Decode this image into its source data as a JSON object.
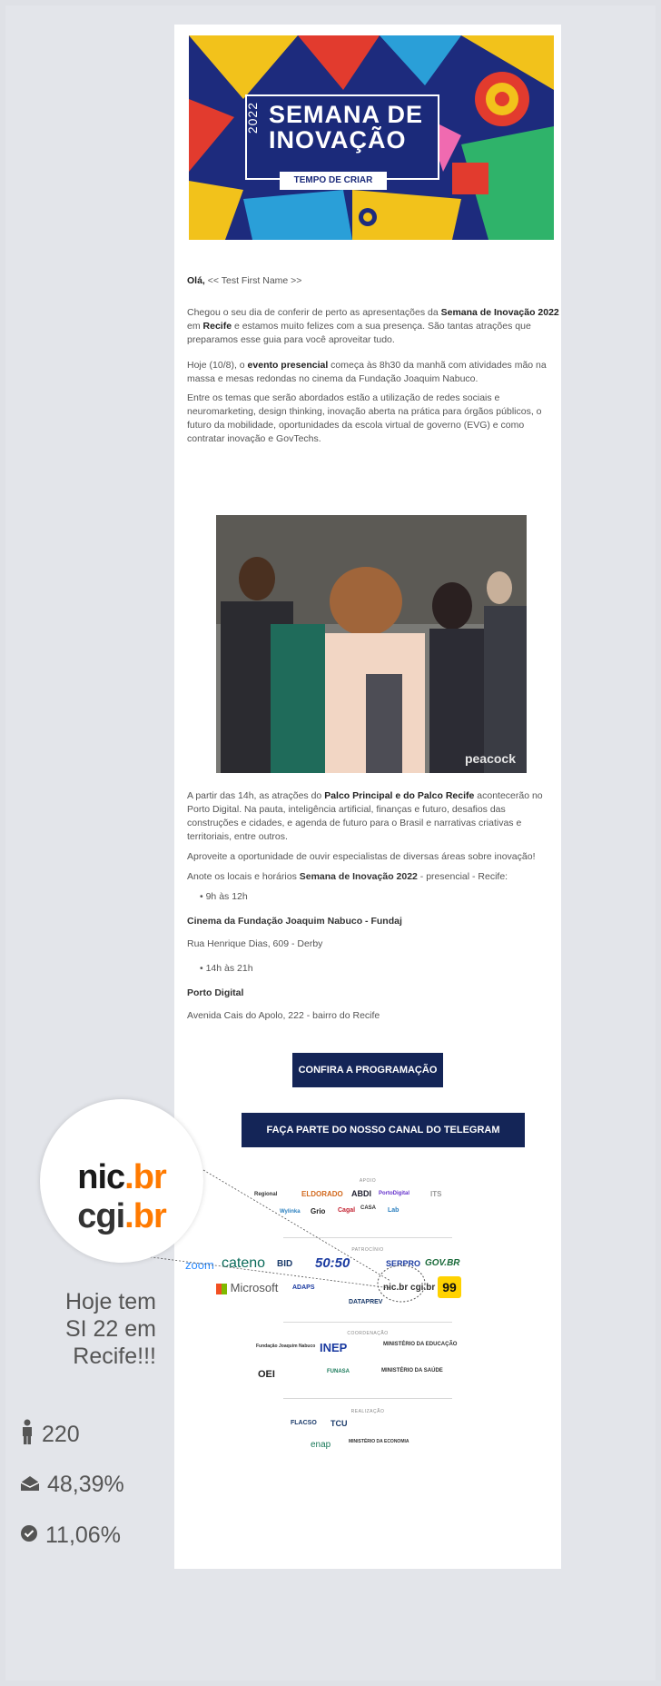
{
  "banner": {
    "year": "2022",
    "title_line1": "SEMANA DE",
    "title_line2": "INOVAÇÃO",
    "tagline": "TEMPO DE CRIAR"
  },
  "email": {
    "greeting_bold": "Olá,",
    "greeting_name": " << Test First Name >>",
    "p1_a": "Chegou o seu dia de conferir de perto as apresentações da ",
    "p1_b": "Semana de Inovação 2022",
    "p1_c": " em ",
    "p1_d": "Recife",
    "p1_e": " e estamos muito felizes com a sua presença. São tantas atrações que preparamos esse guia para você aproveitar tudo.",
    "p2_a": "Hoje (10/8), o ",
    "p2_b": "evento presencial",
    "p2_c": " começa às 8h30 da manhã com atividades mão na massa e mesas redondas no cinema da Fundação Joaquim Nabuco.",
    "p3": "Entre os temas que serão abordados estão a utilização de redes sociais e neuromarketing, design thinking, inovação aberta na prática para órgãos públicos, o futuro da mobilidade, oportunidades da escola virtual de governo (EVG) e como contratar inovação e GovTechs.",
    "gif_watermark": "peacock",
    "p4_a": "A partir das 14h, as atrações do ",
    "p4_b": "Palco Principal e do Palco Recife",
    "p4_c": " acontecerão no Porto Digital. Na pauta, inteligência artificial, finanças e futuro, desafios das construções e cidades, e agenda de futuro para o Brasil e narrativas criativas e territoriais, entre outros.",
    "p5": "Aproveite a oportunidade de ouvir especialistas de diversas áreas sobre inovação!",
    "p6_a": "Anote os  locais e horários ",
    "p6_b": "Semana de Inovação 2022",
    "p6_c": " - presencial - Recife:",
    "time1": "9h às 12h",
    "place1": "Cinema da Fundação Joaquim Nabuco - Fundaj",
    "addr1": "Rua Henrique Dias, 609 - Derby",
    "time2": "14h às 21h",
    "place2": "Porto Digital",
    "addr2": "Avenida Cais do Apolo, 222 - bairro do Recife",
    "btn_program": "CONFIRA A PROGRAMAÇÃO",
    "btn_telegram": "FAÇA PARTE DO NOSSO CANAL DO TELEGRAM"
  },
  "logos": {
    "apoio_label": "APOIO",
    "apoio": [
      "Regional",
      "ELDORADO",
      "ABDI",
      "PortoDigital",
      "ITS",
      "Wylinka",
      "Grio",
      "Cagal",
      "CASA",
      "Lab"
    ],
    "patrocinio_label": "PATROCÍNIO",
    "patrocinio": [
      "zoom",
      "cateno",
      "BID",
      "50:50",
      "SERPRO",
      "GOV.BR",
      "Microsoft",
      "ADAPS",
      "DATAPREV",
      "nic.br cgi.br",
      "99"
    ],
    "coord_label": "COORDENAÇÃO",
    "coord": [
      "Fundação Joaquim Nabuco",
      "INEP",
      "MINISTÉRIO DA EDUCAÇÃO",
      "OEI",
      "FUNASA",
      "MINISTÉRIO DA SAÚDE"
    ],
    "real_label": "REALIZAÇÃO",
    "real": [
      "FLACSO",
      "TCU",
      "enap",
      "MINISTÉRIO DA ECONOMIA"
    ]
  },
  "zoom_callout": {
    "nic": "nic",
    "br1": ".br",
    "cgi": "cgi",
    "br2": ".br"
  },
  "side_panel": {
    "note": "Hoje tem SI 22 em Recife!!!",
    "recipients": "220",
    "open_rate": "48,39%",
    "click_rate": "11,06%"
  }
}
